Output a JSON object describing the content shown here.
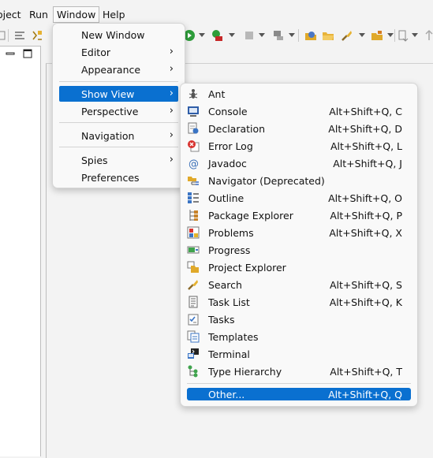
{
  "menubar": {
    "items": [
      {
        "label": "oject"
      },
      {
        "label": "Run"
      },
      {
        "label": "Window"
      },
      {
        "label": "Help"
      }
    ]
  },
  "window_menu": {
    "items": [
      {
        "label": "New Window",
        "submenu": false
      },
      {
        "label": "Editor",
        "submenu": true
      },
      {
        "label": "Appearance",
        "submenu": true
      },
      {
        "label": "Show View",
        "submenu": true,
        "highlighted": true
      },
      {
        "label": "Perspective",
        "submenu": true
      },
      {
        "label": "Navigation",
        "submenu": true
      },
      {
        "label": "Spies",
        "submenu": true
      },
      {
        "label": "Preferences",
        "submenu": false
      }
    ],
    "arrow_glyph": "›"
  },
  "show_view_menu": {
    "items": [
      {
        "label": "Ant",
        "shortcut": "",
        "icon": "ant-icon"
      },
      {
        "label": "Console",
        "shortcut": "Alt+Shift+Q, C",
        "icon": "console-icon"
      },
      {
        "label": "Declaration",
        "shortcut": "Alt+Shift+Q, D",
        "icon": "declaration-icon"
      },
      {
        "label": "Error Log",
        "shortcut": "Alt+Shift+Q, L",
        "icon": "error-log-icon"
      },
      {
        "label": "Javadoc",
        "shortcut": "Alt+Shift+Q, J",
        "icon": "javadoc-icon"
      },
      {
        "label": "Navigator (Deprecated)",
        "shortcut": "",
        "icon": "navigator-icon"
      },
      {
        "label": "Outline",
        "shortcut": "Alt+Shift+Q, O",
        "icon": "outline-icon"
      },
      {
        "label": "Package Explorer",
        "shortcut": "Alt+Shift+Q, P",
        "icon": "package-explorer-icon"
      },
      {
        "label": "Problems",
        "shortcut": "Alt+Shift+Q, X",
        "icon": "problems-icon"
      },
      {
        "label": "Progress",
        "shortcut": "",
        "icon": "progress-icon"
      },
      {
        "label": "Project Explorer",
        "shortcut": "",
        "icon": "project-explorer-icon"
      },
      {
        "label": "Search",
        "shortcut": "Alt+Shift+Q, S",
        "icon": "search-icon"
      },
      {
        "label": "Task List",
        "shortcut": "Alt+Shift+Q, K",
        "icon": "task-list-icon"
      },
      {
        "label": "Tasks",
        "shortcut": "",
        "icon": "tasks-icon"
      },
      {
        "label": "Templates",
        "shortcut": "",
        "icon": "templates-icon"
      },
      {
        "label": "Terminal",
        "shortcut": "",
        "icon": "terminal-icon"
      },
      {
        "label": "Type Hierarchy",
        "shortcut": "Alt+Shift+Q, T",
        "icon": "type-hierarchy-icon"
      },
      {
        "label": "Other...",
        "shortcut": "Alt+Shift+Q, Q",
        "icon": "",
        "highlighted": true
      }
    ]
  },
  "colors": {
    "highlight": "#0a70d0",
    "menu_bg": "#f9f9f9",
    "window_bg": "#f3f3f3"
  }
}
